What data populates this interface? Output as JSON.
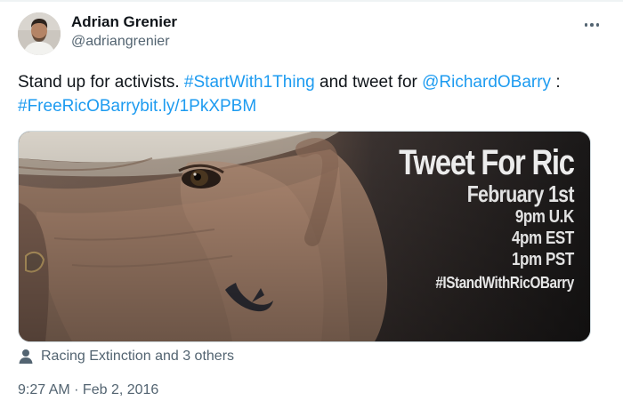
{
  "author": {
    "name": "Adrian Grenier",
    "handle": "@adriangrenier"
  },
  "tweet": {
    "text_1": "Stand up for activists. ",
    "hashtag_1": "#StartWith1Thing",
    "text_2": " and tweet for ",
    "mention_1": "@RichardOBarry",
    "text_3": " :",
    "hashtag_2": "#FreeRicOBarry",
    "link_1": "bit.ly/1PkXPBM"
  },
  "media": {
    "title": "Tweet For Ric",
    "date": "February 1st",
    "times": [
      "9pm U.K",
      "4pm EST",
      "1pm PST"
    ],
    "hashtag": "#IStandWithRicOBarry",
    "icon": "dolphin-tattoo"
  },
  "tagged": {
    "icon": "person-icon",
    "label": "Racing Extinction and 3 others"
  },
  "timestamp": "9:27 AM · Feb 2, 2016",
  "colors": {
    "link": "#1d9bf0",
    "secondary": "#536471",
    "text": "#0f1419"
  }
}
